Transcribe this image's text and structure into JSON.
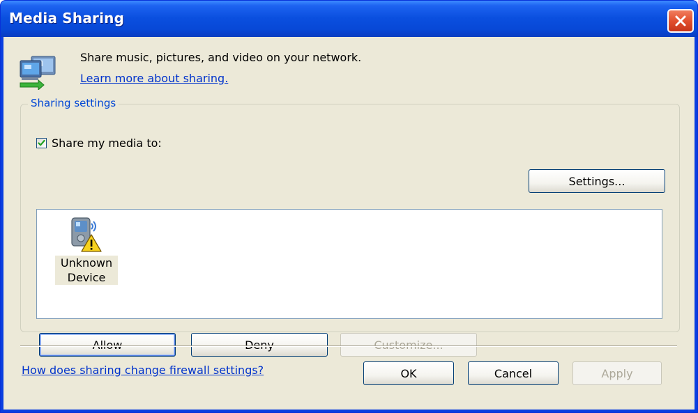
{
  "window": {
    "title": "Media Sharing"
  },
  "intro": {
    "description": "Share music, pictures, and video on your network.",
    "learn_more_link": "Learn more about sharing."
  },
  "sharing_settings": {
    "legend": "Sharing settings",
    "share_checkbox_label": "Share my media to:",
    "share_checkbox_checked": true,
    "settings_button": "Settings...",
    "devices": [
      {
        "label_line1": "Unknown",
        "label_line2": "Device",
        "icon": "media-device-warning-icon"
      }
    ],
    "allow_button": "Allow",
    "deny_button": "Deny",
    "customize_button": "Customize..."
  },
  "footer": {
    "firewall_link": "How does sharing change firewall settings?",
    "ok_button": "OK",
    "cancel_button": "Cancel",
    "apply_button": "Apply"
  },
  "colors": {
    "titlebar": "#0a4fdf",
    "dialog_face": "#ece9d8",
    "link": "#0033cc",
    "group_legend": "#0046d5"
  }
}
